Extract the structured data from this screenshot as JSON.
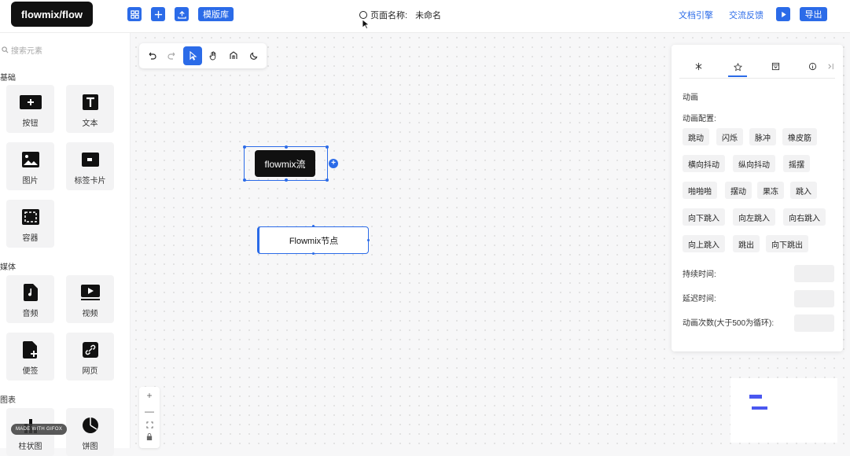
{
  "header": {
    "logo": "flowmix/flow",
    "template_label": "模版库",
    "page_name_label": "页面名称:",
    "page_name_value": "未命名",
    "docs_link": "文档引擎",
    "feedback_link": "交流反馈",
    "export_label": "导出",
    "accent": "#2b6be8"
  },
  "sidebar": {
    "search_placeholder": "搜索元素",
    "sections": {
      "basic": "基础",
      "media": "媒体",
      "chart": "图表"
    },
    "items": [
      {
        "label": "按钮",
        "icon": "button-icon"
      },
      {
        "label": "文本",
        "icon": "text-icon"
      },
      {
        "label": "图片",
        "icon": "image-icon"
      },
      {
        "label": "标签卡片",
        "icon": "tag-card-icon"
      },
      {
        "label": "容器",
        "icon": "container-icon"
      },
      {
        "label": "音频",
        "icon": "audio-icon"
      },
      {
        "label": "视频",
        "icon": "video-icon"
      },
      {
        "label": "便签",
        "icon": "note-icon"
      },
      {
        "label": "网页",
        "icon": "webpage-icon"
      },
      {
        "label": "柱状图",
        "icon": "bar-chart-icon"
      },
      {
        "label": "饼图",
        "icon": "pie-chart-icon"
      }
    ],
    "watermark": "MADE WITH GIFOX"
  },
  "canvas": {
    "node1_text": "flowmix流",
    "node2_text": "Flowmix节点"
  },
  "panel": {
    "section_title": "动画",
    "config_label": "动画配置:",
    "animations": [
      "跳动",
      "闪烁",
      "脉冲",
      "橡皮筋",
      "横向抖动",
      "纵向抖动",
      "摇摆",
      "啪啪啪",
      "摆动",
      "果冻",
      "跳入",
      "向下跳入",
      "向左跳入",
      "向右跳入",
      "向上跳入",
      "跳出",
      "向下跳出"
    ],
    "duration_label": "持续时间:",
    "delay_label": "延迟时间:",
    "count_label": "动画次数(大于500为循环):"
  }
}
